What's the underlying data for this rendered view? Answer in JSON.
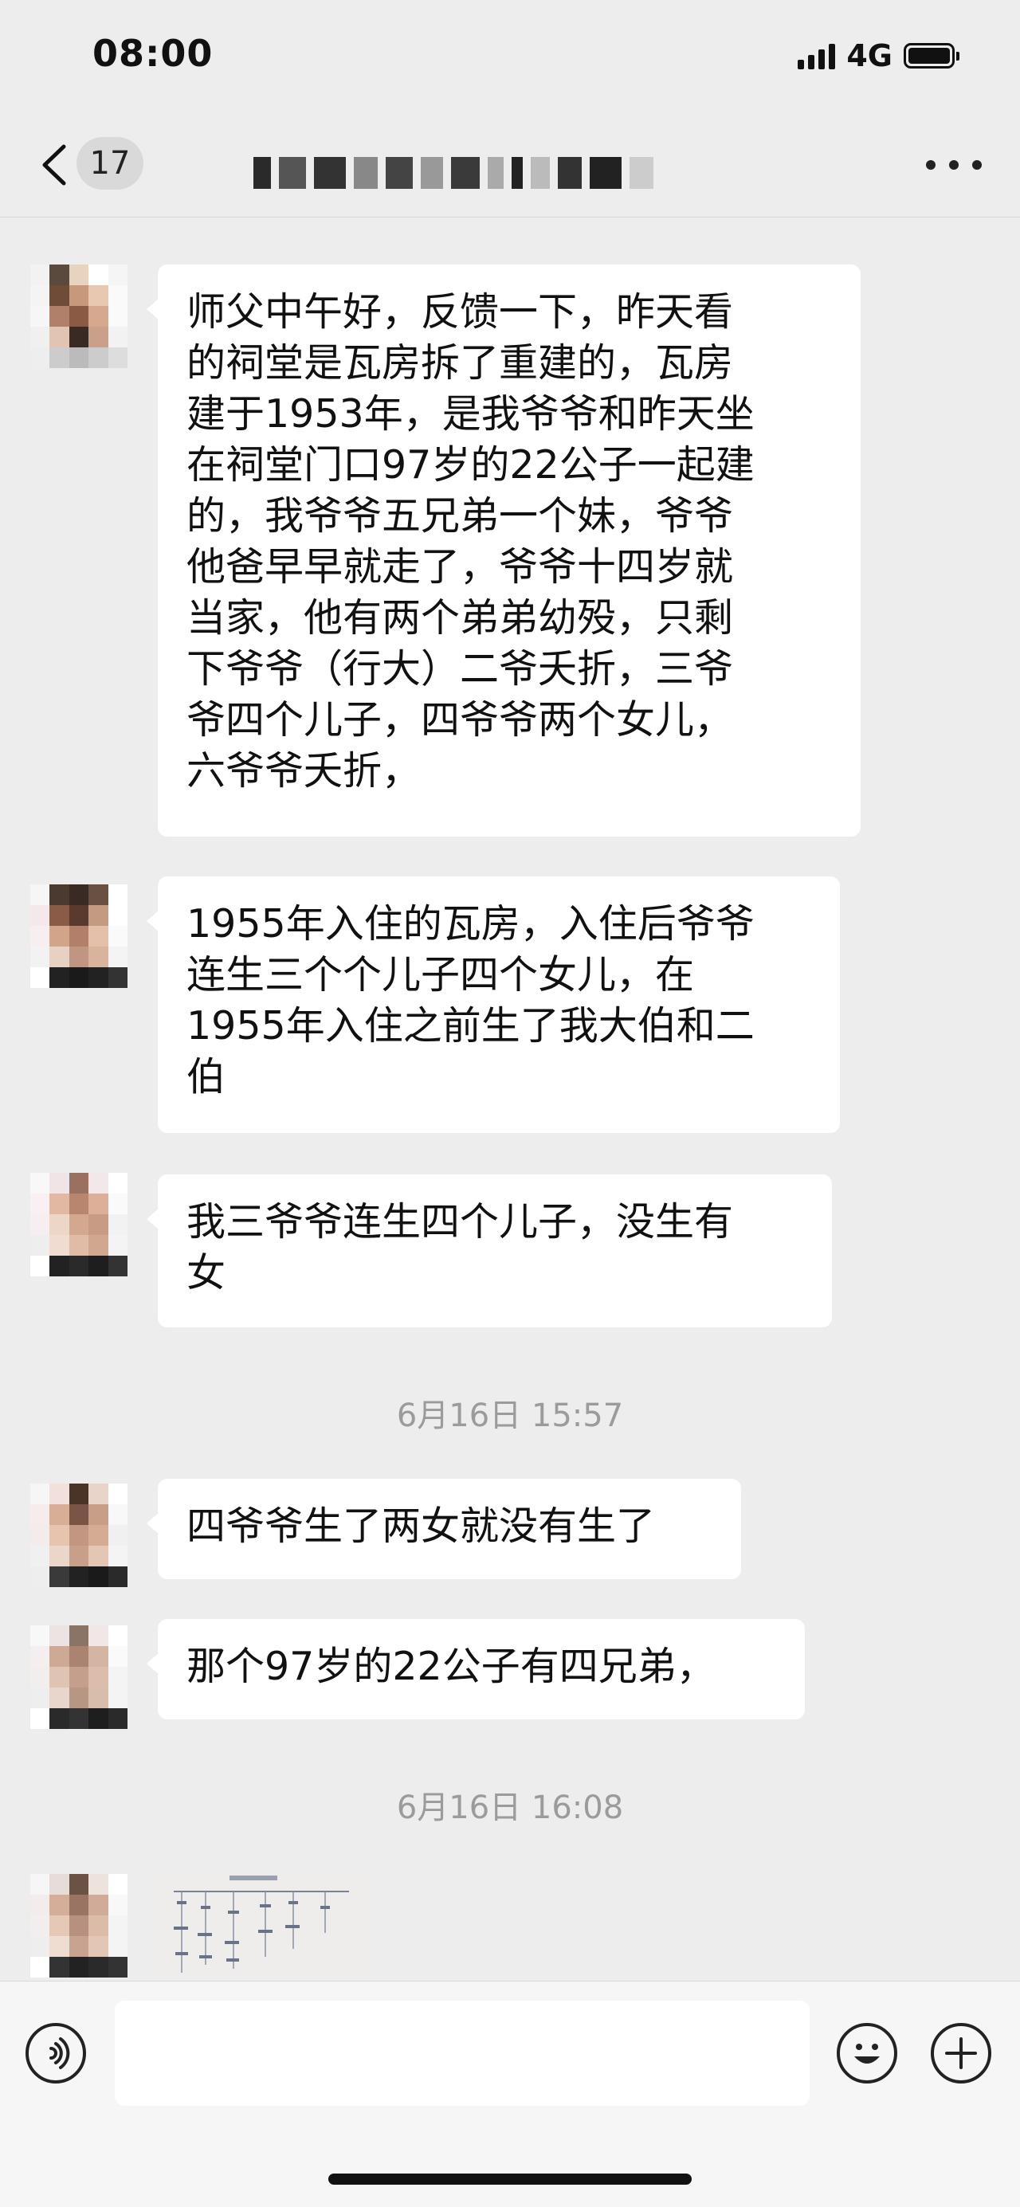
{
  "status_bar": {
    "time": "08:00",
    "network": "4G"
  },
  "header": {
    "unread_count": "17"
  },
  "messages": [
    {
      "text": "师父中午好，反馈一下，昨天看\n的祠堂是瓦房拆了重建的，瓦房\n建于1953年，是我爷爷和昨天坐\n在祠堂门口97岁的22公子一起建\n的，我爷爷五兄弟一个妹，爷爷\n他爸早早就走了，爷爷十四岁就\n当家，他有两个弟弟幼殁，只剩\n下爷爷（行大）二爷夭折，三爷\n爷四个儿子，四爷爷两个女儿，\n六爷爷夭折，"
    },
    {
      "text": "1955年入住的瓦房，入住后爷爷\n连生三个个儿子四个女儿，在\n1955年入住之前生了我大伯和二\n伯"
    },
    {
      "text": "我三爷爷连生四个儿子，没生有\n女"
    },
    {
      "text": "四爷爷生了两女就没有生了"
    },
    {
      "text": "那个97岁的22公子有四兄弟，"
    }
  ],
  "timestamps": [
    "6月16日 15:57",
    "6月16日 16:08"
  ],
  "input": {
    "placeholder": ""
  }
}
